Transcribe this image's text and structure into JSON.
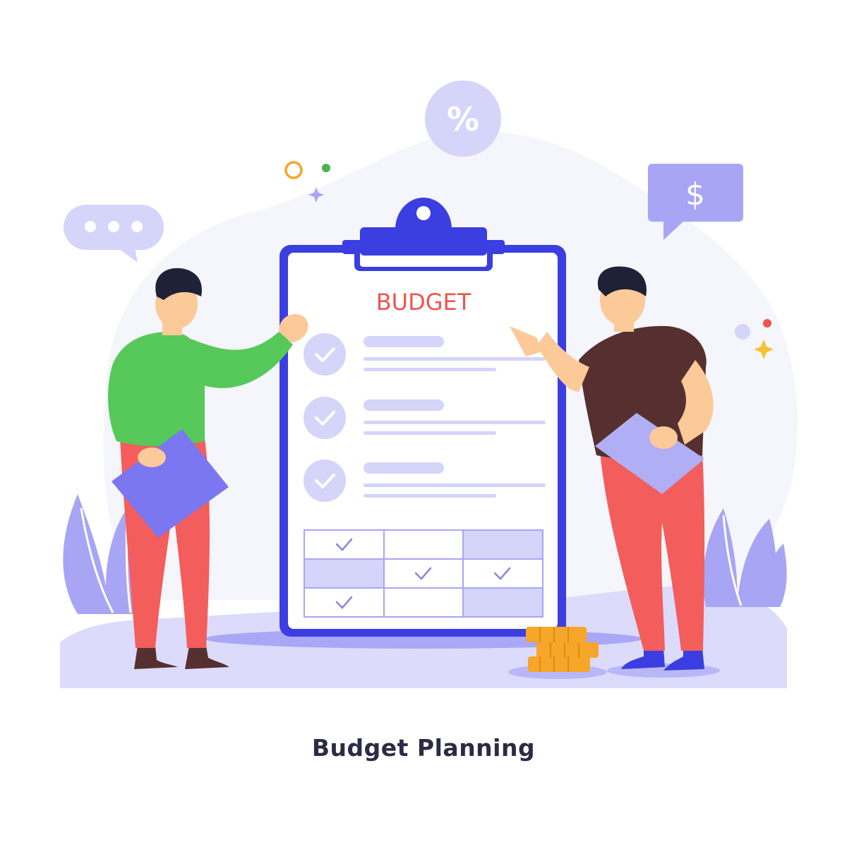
{
  "illustration": {
    "board_title": "BUDGET",
    "percent_symbol": "%",
    "dollar_symbol": "$",
    "caption": "Budget Planning"
  },
  "colors": {
    "background": "#ffffff",
    "backdrop_blob": "#f5f5fc",
    "ground": "#dcdbfb",
    "board_frame": "#3b3ee0",
    "board_paper": "#ffffff",
    "title_red": "#f0544f",
    "lavender": "#d5d4f9",
    "check_stroke": "#8a87dd",
    "tablet": "#7b77f0",
    "green_shirt": "#56c95a",
    "pants_red": "#f35d5c",
    "brown_shirt": "#55302f",
    "skin": "#fcc999",
    "hair": "#1f2136",
    "coin": "#f6a628",
    "plant": "#a8a5f5",
    "caption_text": "#2b2c44"
  },
  "icons": [
    "percent-bubble-icon",
    "dollar-speech-bubble-icon",
    "chat-bubble-icon",
    "sparkle-icon",
    "check-circle-icon",
    "checkmark-icon",
    "coin-stack-icon",
    "plant-icon",
    "tablet-icon"
  ]
}
